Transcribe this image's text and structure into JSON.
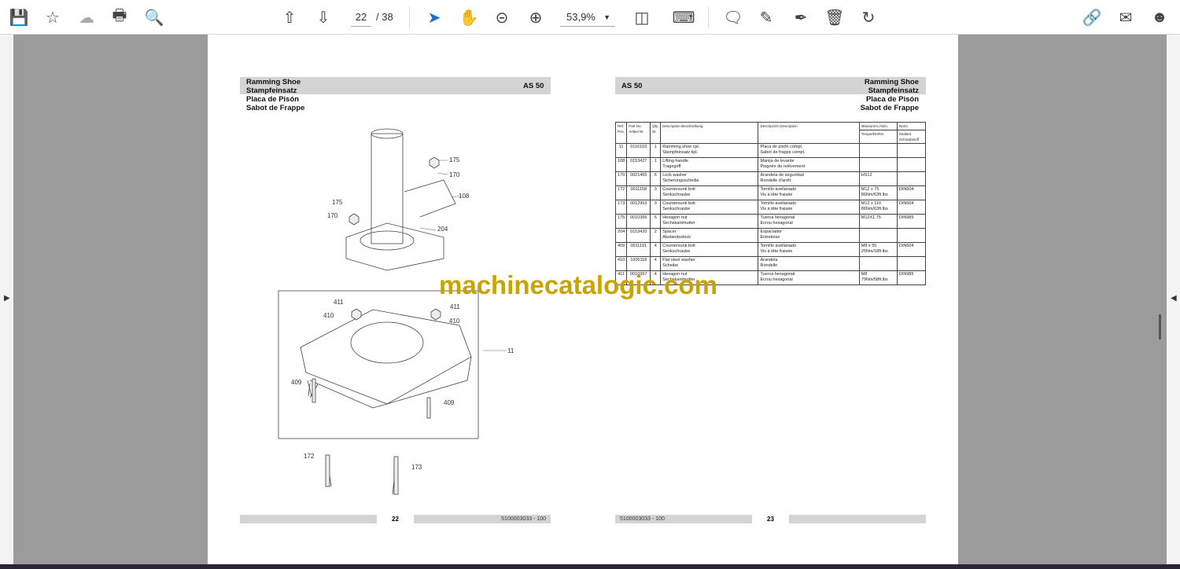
{
  "toolbar": {
    "page_current": "22",
    "page_total": "/ 38",
    "zoom": "53,9%"
  },
  "left_page": {
    "title_lines": [
      "Ramming Shoe",
      "Stampfeinsatz",
      "Placa de Pisón",
      "Sabot de Frappe"
    ],
    "model": "AS 50",
    "callouts": [
      "175",
      "170",
      "108",
      "175",
      "170",
      "204",
      "411",
      "410",
      "411",
      "410",
      "11",
      "409",
      "409",
      "172",
      "173"
    ],
    "page_number": "22",
    "doc_number": "5100003033 - 100"
  },
  "right_page": {
    "model": "AS 50",
    "title_lines": [
      "Ramming Shoe",
      "Stampfeinsatz",
      "Placa de Pisón",
      "Sabot de Frappe"
    ],
    "table": {
      "headers": [
        "Ref. Pos.",
        "Part No. Artikel Nr.",
        "Qty. St.",
        "Description Beschreibung",
        "Descripción Description",
        "Measurem./Abm.",
        "Norm"
      ],
      "subheaders": [
        "Torque/Drehm.",
        "Sealant Schraubstoff"
      ],
      "rows": [
        [
          "11",
          "0116103",
          "1",
          "Ramming shoe cpl.\nStampfeinsatz kpl.",
          "Placa de pisón compl.\nSabot de frappe compl.",
          "",
          ""
        ],
        [
          "108",
          "0153427",
          "1",
          "Lifting handle\nTragegriff",
          "Manija de levante\nPoignée de relèvement",
          "",
          ""
        ],
        [
          "170",
          "0021465",
          "6",
          "Lock washer\nSicherungsscheibe",
          "Arandela de seguridad\nRondelle d'arrêt",
          "HS12",
          ""
        ],
        [
          "172",
          "0011158",
          "3",
          "Countersunk bolt\nSenkschraube",
          "Tornillo avellanado\nVis à tête fraisée",
          "M12 x 75\n86Nm/63ft.lbs",
          "DIN604"
        ],
        [
          "173",
          "0012953",
          "3",
          "Countersunk bolt\nSenkschraube",
          "Tornillo avellanado\nVis à tête fraisée",
          "M12 x 110\n86Nm/63ft.lbs",
          "DIN604"
        ],
        [
          "175",
          "0010366",
          "6",
          "Hexagon nut\nSechskantmutter",
          "Tuerca hexagonal\nEcrou hexagonal",
          "M12X1.75",
          "DIN985"
        ],
        [
          "204",
          "0153420",
          "2",
          "Spacer\nAbstandsstück",
          "Espaciador\nEntretoise",
          "",
          ""
        ],
        [
          "409",
          "0011191",
          "4",
          "Countersunk bolt\nSenkschraube",
          "Tornillo avellanado\nVis à tête fraisée",
          "M8 x 55\n25Nm/18ft.lbs",
          "DIN604"
        ],
        [
          "410",
          "1005118",
          "4",
          "Flat steel washer\nScheibe",
          "Arandela\nRondelle",
          "",
          ""
        ],
        [
          "411",
          "0010367",
          "4",
          "Hexagon nut\nSechskantmutter",
          "Tuerca hexagonal\nEcrou hexagonal",
          "M8\n79Nm/58ft.lbs",
          "DIN985"
        ]
      ]
    },
    "page_number": "23",
    "doc_number": "5100003033 - 100"
  },
  "watermark": "machinecatalogic.com"
}
